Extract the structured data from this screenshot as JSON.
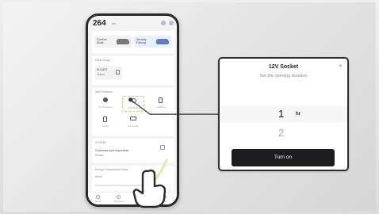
{
  "phone": {
    "range_value": "264",
    "range_unit": "km",
    "mode_cards": [
      {
        "label": "Comfort Mode"
      },
      {
        "label": "Security Parking"
      }
    ],
    "drive_image": {
      "title": "Drive Image",
      "item": "ADJUST",
      "sub": "Status"
    },
    "new_features": {
      "title": "New Features",
      "items": [
        {
          "label": "Tire Pressure"
        },
        {
          "label": "12V Socket"
        },
        {
          "label": "Charging"
        },
        {
          "label": "Locks"
        },
        {
          "label": "Car Finder"
        }
      ]
    },
    "stores": {
      "title": "STORES",
      "item": "Customize your experience",
      "sub": "Details"
    },
    "energy": {
      "title": "Energy Consumption Data",
      "sub": "Week"
    },
    "nav": [
      {
        "label": "Home"
      },
      {
        "label": "Discover"
      },
      {
        "label": "My Car"
      },
      {
        "label": "Me"
      }
    ],
    "active_nav": 2
  },
  "dialog": {
    "title": "12V Socket",
    "close_icon": "close-icon",
    "subtitle": "Set the opening duration",
    "picker_selected": "1",
    "picker_unit": "hr",
    "picker_next": "2",
    "turn_on_label": "Turn on"
  },
  "colors": {
    "accent_green": "#b5d96b",
    "button_dark": "#1d1d1f",
    "frame": "#2a2a2a"
  }
}
